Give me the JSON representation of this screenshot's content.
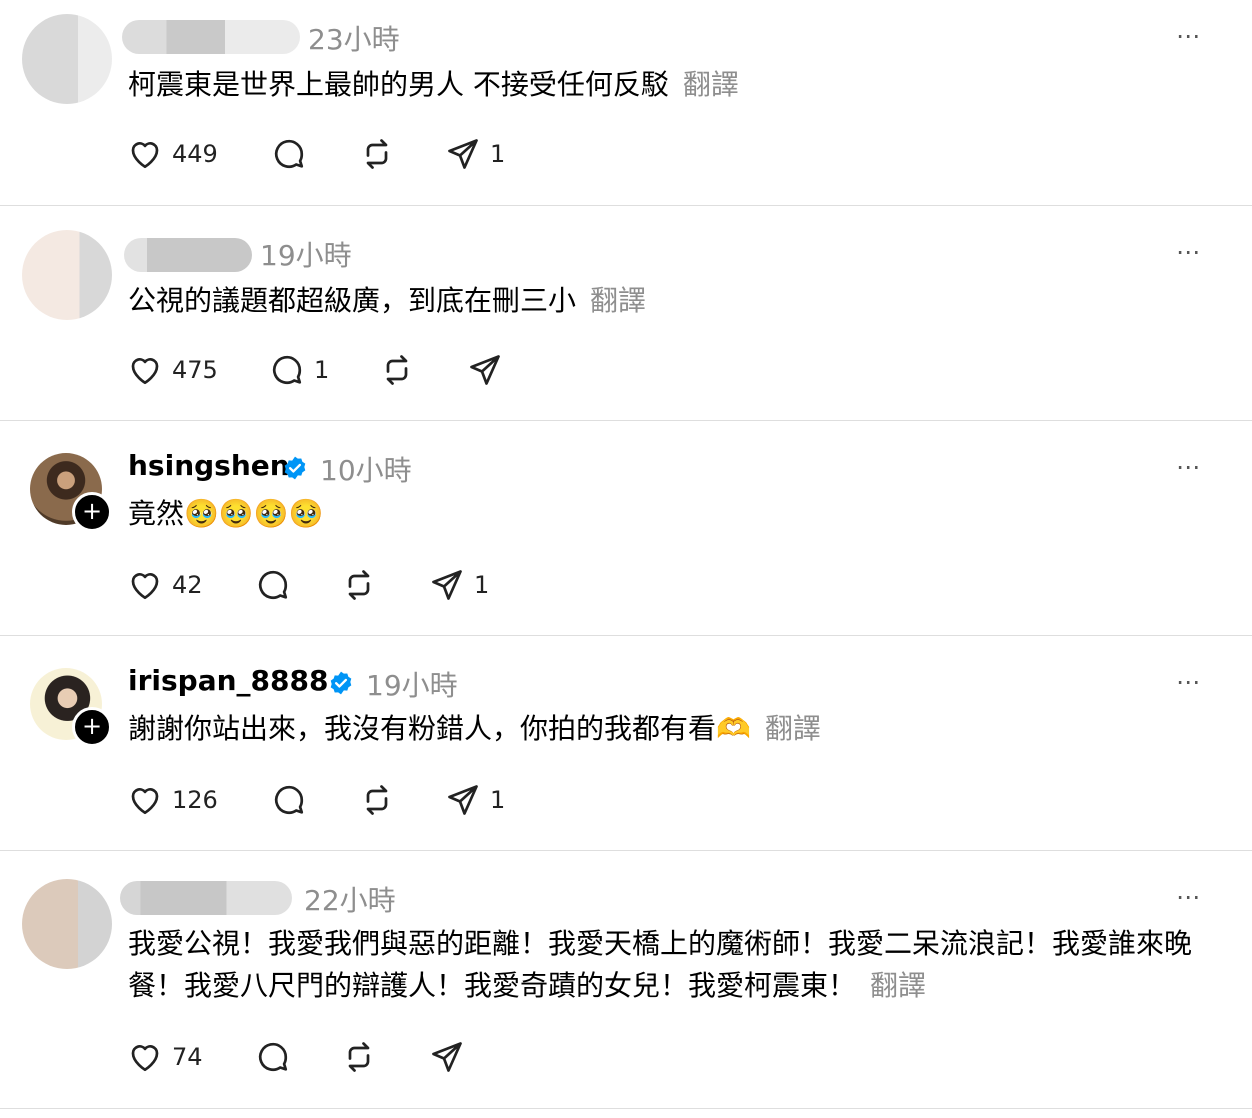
{
  "translate_label": "翻譯",
  "more_icon": "⋯",
  "posts": [
    {
      "time": "23小時",
      "text": "柯震東是世界上最帥的男人 不接受任何反駁",
      "likes": "449",
      "replies": "",
      "reposts": "",
      "shares": "1"
    },
    {
      "time": "19小時",
      "text": "公視的議題都超級廣，到底在刪三小",
      "likes": "475",
      "replies": "1",
      "reposts": "",
      "shares": ""
    },
    {
      "username": "hsingshen",
      "time": "10小時",
      "text": "竟然🥹🥹🥹🥹",
      "likes": "42",
      "replies": "",
      "reposts": "",
      "shares": "1"
    },
    {
      "username": "irispan_8888",
      "time": "19小時",
      "text": "謝謝你站出來，我沒有粉錯人，你拍的我都有看🫶",
      "likes": "126",
      "replies": "",
      "reposts": "",
      "shares": "1"
    },
    {
      "time": "22小時",
      "text": "我愛公視！我愛我們與惡的距離！我愛天橋上的魔術師！我愛二呆流浪記！我愛誰來晚餐！我愛八尺門的辯護人！我愛奇蹟的女兒！我愛柯震東！",
      "likes": "74",
      "replies": "",
      "reposts": "",
      "shares": ""
    }
  ],
  "colors": {
    "verified": "#0095f6",
    "secondary_text": "#8e8e8e",
    "divider": "#dedede"
  }
}
